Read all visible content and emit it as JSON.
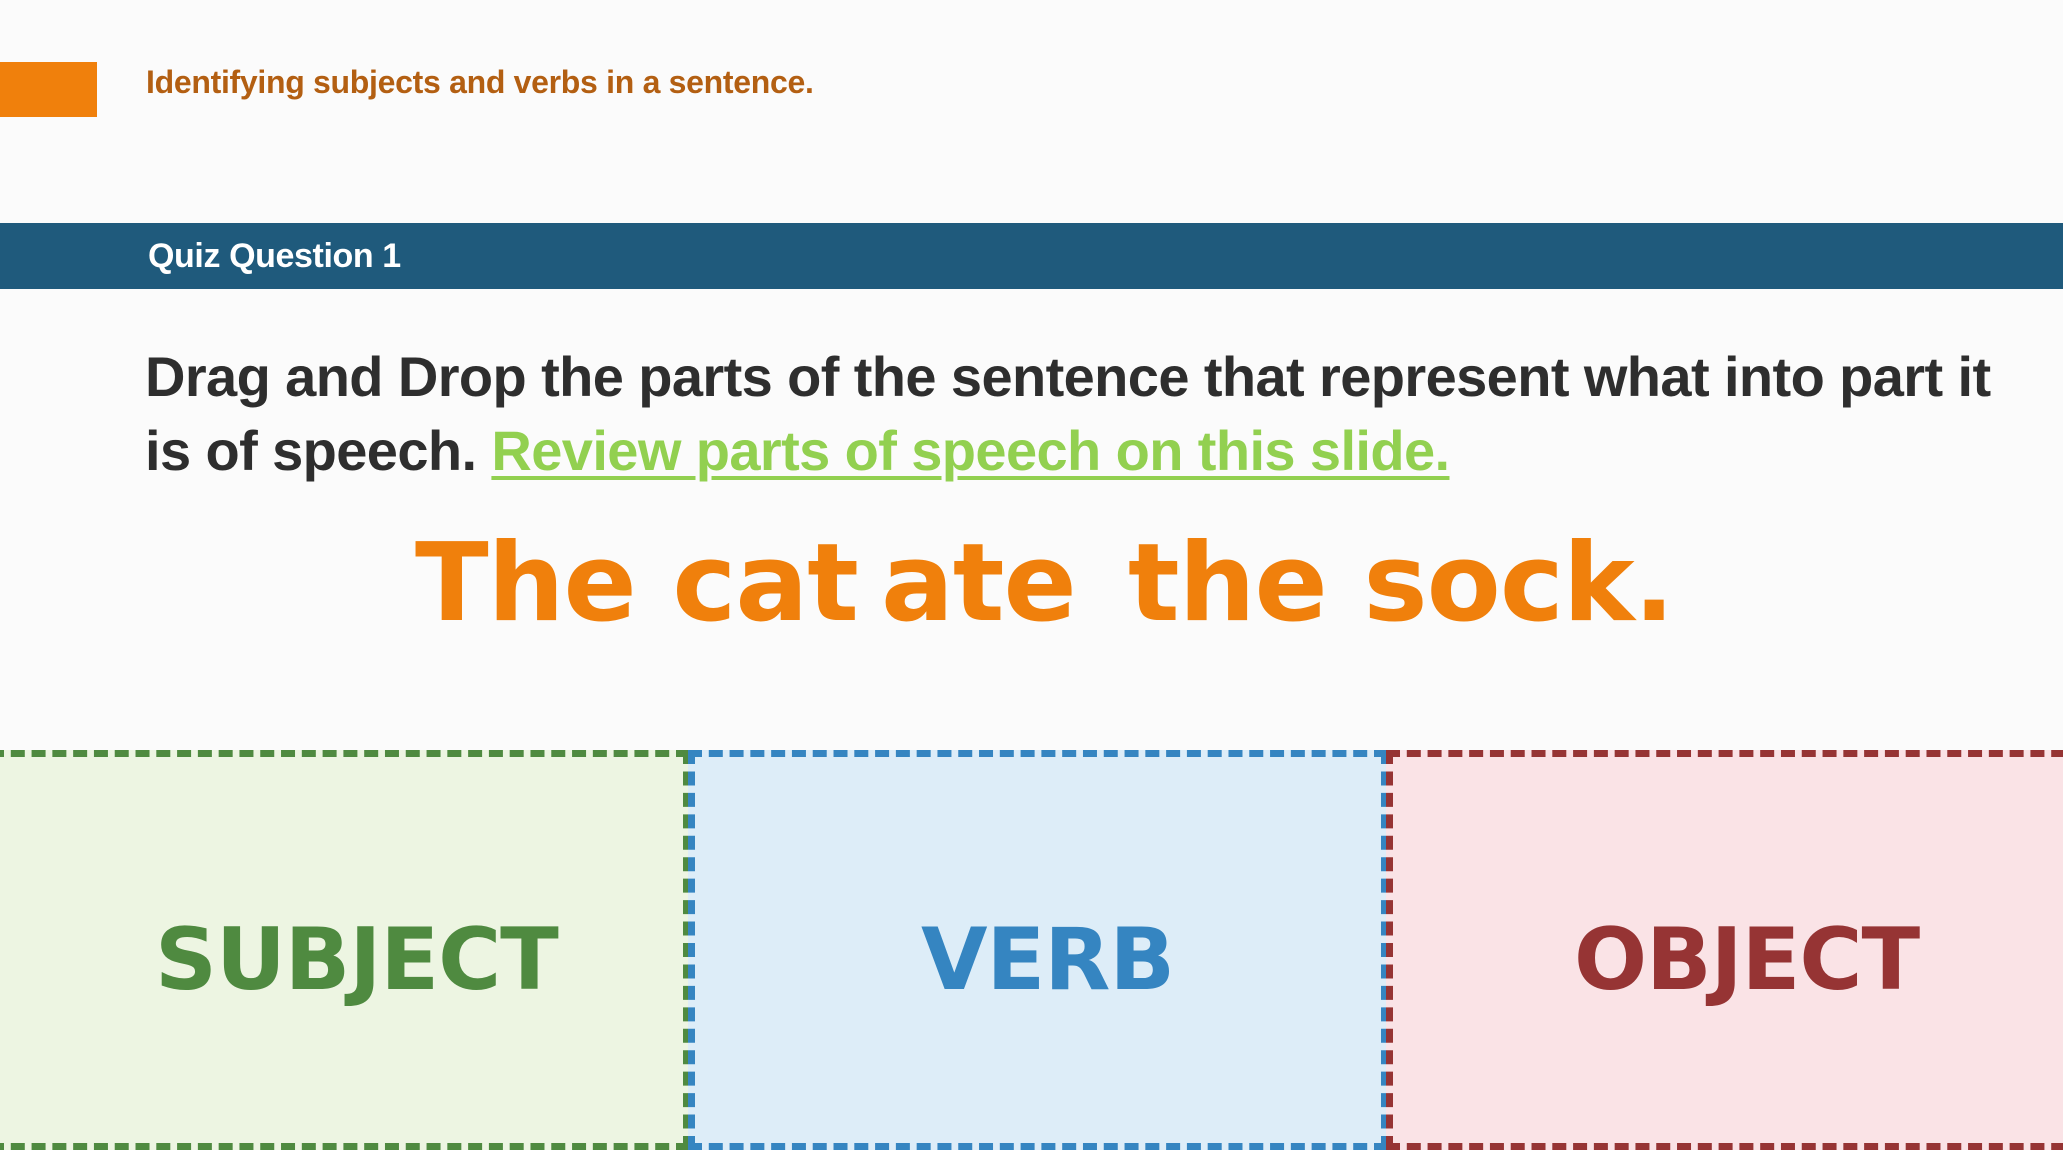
{
  "header": {
    "topic": "Identifying subjects and verbs in a sentence."
  },
  "banner": {
    "title": "Quiz Question 1"
  },
  "question": {
    "instruction": "Drag and Drop the parts of the sentence that represent what into part it is of speech.",
    "review_link": "Review parts of speech on this slide."
  },
  "sentence": {
    "words": [
      "The cat",
      "ate",
      "the sock."
    ]
  },
  "drop_zones": [
    {
      "label": "SUBJECT",
      "color": "#4f8a40",
      "background": "#edf5e2"
    },
    {
      "label": "VERB",
      "color": "#3585c1",
      "background": "#ddedf8"
    },
    {
      "label": "OBJECT",
      "color": "#963434",
      "background": "#fae3e6"
    }
  ],
  "colors": {
    "accent": "#f0800c",
    "banner": "#1f5a7c",
    "link": "#92d050",
    "text": "#2e2e2e"
  }
}
